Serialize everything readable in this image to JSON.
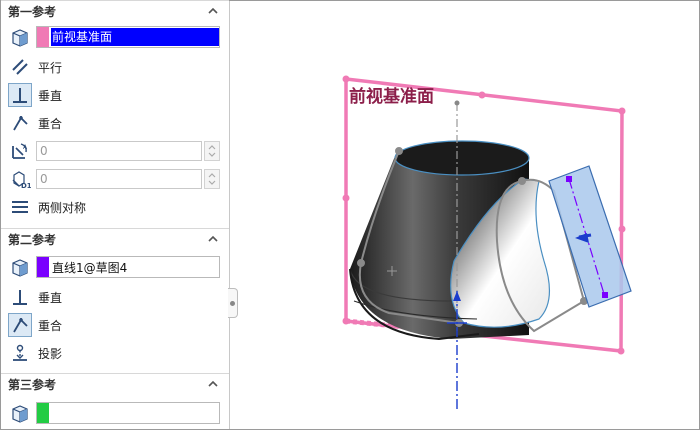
{
  "panel": {
    "ref1": {
      "title": "第一参考",
      "selection": "前视基准面",
      "selection_color": "#f07ab5",
      "options": [
        {
          "label": "平行",
          "icon": "parallel-icon"
        },
        {
          "label": "垂直",
          "icon": "perpendicular-icon"
        },
        {
          "label": "重合",
          "icon": "coincident-icon"
        }
      ],
      "angle_value": "0",
      "offset_value": "0",
      "symmetric_label": "两侧对称"
    },
    "ref2": {
      "title": "第二参考",
      "selection": "直线1@草图4",
      "selection_color": "#7a00ff",
      "options": [
        {
          "label": "垂直",
          "icon": "perpendicular-icon"
        },
        {
          "label": "重合",
          "icon": "coincident-icon"
        },
        {
          "label": "投影",
          "icon": "project-icon"
        }
      ]
    },
    "ref3": {
      "title": "第三参考",
      "selection": "",
      "selection_color": "#22cc44"
    }
  },
  "viewport": {
    "plane_label": "前视基准面",
    "plane_color": "#f07ab5",
    "preview_plane_color": "#a9c8ec"
  }
}
